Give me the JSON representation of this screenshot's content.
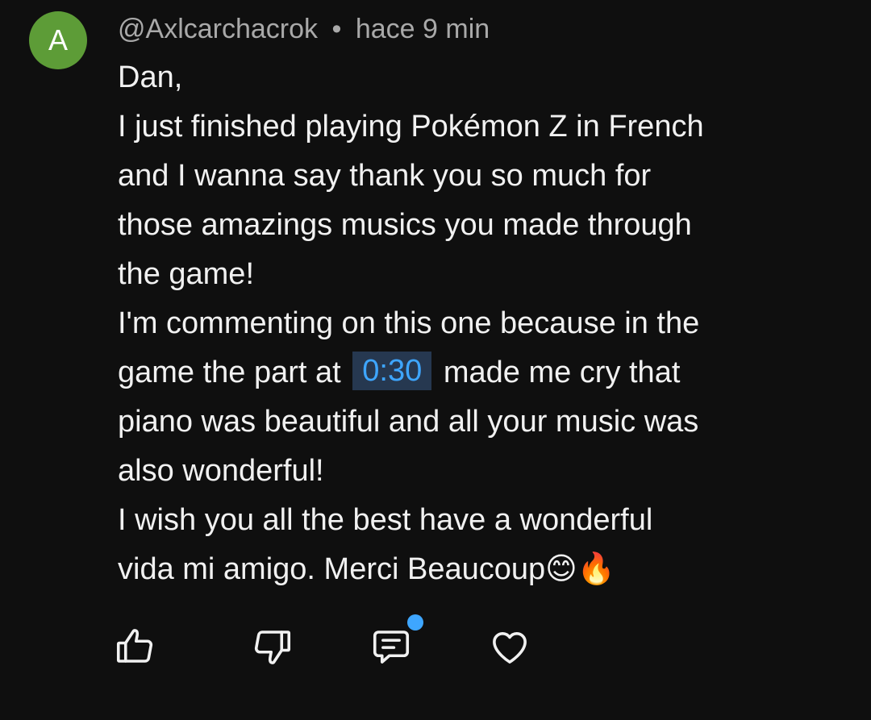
{
  "comment": {
    "avatar_letter": "A",
    "author": "@Axlcarchacrok",
    "separator": "•",
    "time": "hace 9 min",
    "lines": {
      "l1": "Dan,",
      "l2": "I just finished playing Pokémon Z in French",
      "l3": "and I wanna say thank you so much for",
      "l4": "those amazings musics you made through",
      "l5": "the game!",
      "l6": "I'm commenting on this one because in the",
      "l7_before": "game the part at",
      "l7_timestamp": "0:30",
      "l7_after": "made me cry that",
      "l8": "piano was beautiful and all your music was",
      "l9": "also wonderful!",
      "l10": "I wish you all the best have a wonderful",
      "l11": "vida mi amigo. Merci Beaucoup😊🔥"
    }
  },
  "actions": {
    "like_icon": "thumbs-up-icon",
    "dislike_icon": "thumbs-down-icon",
    "reply_icon": "comment-icon",
    "heart_icon": "heart-icon",
    "notification_dot": true
  },
  "colors": {
    "background": "#0f0f0f",
    "avatar": "#5d9c37",
    "text": "#f1f1f1",
    "secondary_text": "#a9a9a9",
    "link": "#3ea6ff",
    "timestamp_bg": "#263850"
  }
}
